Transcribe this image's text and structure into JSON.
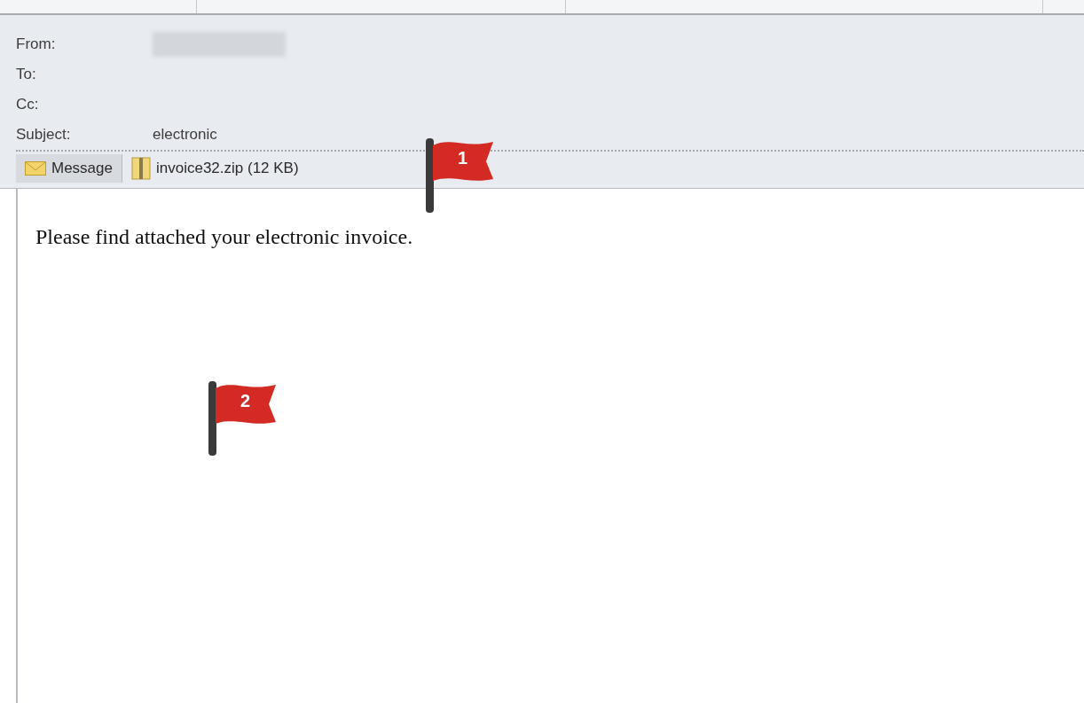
{
  "header": {
    "fields": [
      {
        "label": "From:"
      },
      {
        "label": "To:"
      },
      {
        "label": "Cc:"
      },
      {
        "label": "Subject:",
        "value": "electronic"
      }
    ]
  },
  "tabs": [
    {
      "kind": "message",
      "label": "Message",
      "selected": true
    },
    {
      "kind": "attachment",
      "label": "invoice32.zip (12 KB)",
      "selected": false
    }
  ],
  "body": {
    "text": "Please find attached your electronic invoice."
  },
  "markers": [
    {
      "number": "1"
    },
    {
      "number": "2"
    }
  ]
}
